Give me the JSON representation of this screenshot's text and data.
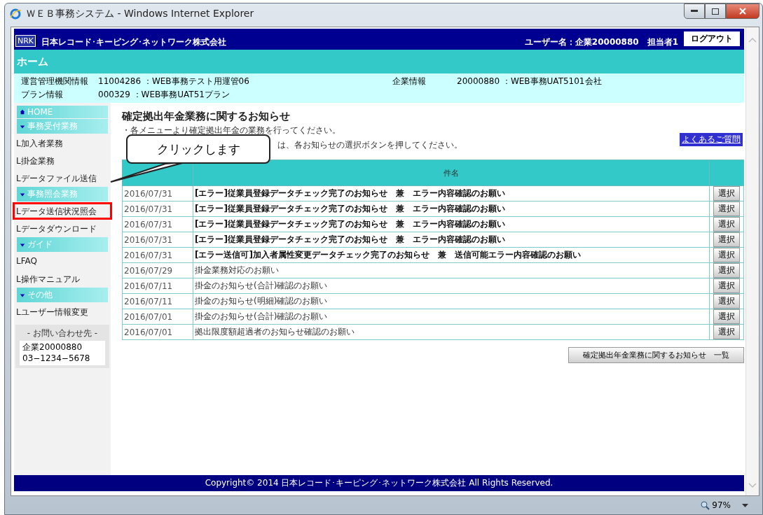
{
  "window": {
    "title": "ＷＥＢ事務システム - Windows Internet Explorer",
    "zoom": "97%"
  },
  "header": {
    "logo": "NRK",
    "company": "日本レコード･キーピング･ネットワーク株式会社",
    "user": "ユーザー名：企業20000880　担当者1",
    "logout": "ログアウト"
  },
  "page_title": "ホーム",
  "info": [
    {
      "label": "運営管理機関情報",
      "value": "11004286 ：WEB事務テスト用運管06"
    },
    {
      "label": "企業情報",
      "value": "20000880 ：WEB事務UAT5101会社"
    },
    {
      "label": "プラン情報",
      "value": "000329 ：WEB事務UAT51プラン"
    }
  ],
  "sidebar": {
    "items": [
      {
        "kind": "home",
        "label": "HOME"
      },
      {
        "kind": "section",
        "label": "事務受付業務"
      },
      {
        "kind": "link",
        "label": "L加入者業務",
        "highlighted": false
      },
      {
        "kind": "link",
        "label": "L掛金業務",
        "highlighted": false
      },
      {
        "kind": "link",
        "label": "Lデータファイル送信",
        "highlighted": false
      },
      {
        "kind": "section",
        "label": "事務照会業務"
      },
      {
        "kind": "link",
        "label": "Lデータ送信状況照会",
        "highlighted": true
      },
      {
        "kind": "link",
        "label": "Lデータダウンロード",
        "highlighted": false
      },
      {
        "kind": "section",
        "label": "ガイド"
      },
      {
        "kind": "link",
        "label": "LFAQ",
        "highlighted": false
      },
      {
        "kind": "link",
        "label": "L操作マニュアル",
        "highlighted": false
      },
      {
        "kind": "section",
        "label": "その他"
      },
      {
        "kind": "link",
        "label": "Lユーザー情報変更",
        "highlighted": false
      }
    ],
    "contact": {
      "title": "- お問い合わせ先 -",
      "lines": [
        "企業20000880",
        "03−1234−5678"
      ]
    }
  },
  "callout": "クリックします",
  "main": {
    "heading": "確定拠出年金業務に関するお知らせ",
    "notes": [
      "・各メニューより確定拠出年金の業務を行ってください。",
      "は、各お知らせの選択ボタンを押してください。"
    ],
    "faq_link": "よくあるご質問",
    "table": {
      "subject_header": "件名",
      "rows": [
        {
          "date": "2016/07/31",
          "subject": "[エラー]従業員登録データチェック完了のお知らせ　兼　エラー内容確認のお願い",
          "emphasis": true,
          "button": "選択"
        },
        {
          "date": "2016/07/31",
          "subject": "[エラー]従業員登録データチェック完了のお知らせ　兼　エラー内容確認のお願い",
          "emphasis": true,
          "button": "選択"
        },
        {
          "date": "2016/07/31",
          "subject": "[エラー]従業員登録データチェック完了のお知らせ　兼　エラー内容確認のお願い",
          "emphasis": true,
          "button": "選択"
        },
        {
          "date": "2016/07/31",
          "subject": "[エラー]従業員登録データチェック完了のお知らせ　兼　エラー内容確認のお願い",
          "emphasis": true,
          "button": "選択"
        },
        {
          "date": "2016/07/31",
          "subject": "[エラー送信可]加入者属性変更データチェック完了のお知らせ　兼　送信可能エラー内容確認のお願い",
          "emphasis": true,
          "button": "選択"
        },
        {
          "date": "2016/07/29",
          "subject": "掛金業務対応のお願い",
          "emphasis": false,
          "button": "選択"
        },
        {
          "date": "2016/07/11",
          "subject": "掛金のお知らせ(合計)確認のお願い",
          "emphasis": false,
          "button": "選択"
        },
        {
          "date": "2016/07/11",
          "subject": "掛金のお知らせ(明細)確認のお願い",
          "emphasis": false,
          "button": "選択"
        },
        {
          "date": "2016/07/01",
          "subject": "掛金のお知らせ(合計)確認のお願い",
          "emphasis": false,
          "button": "選択"
        },
        {
          "date": "2016/07/01",
          "subject": "拠出限度額超過者のお知らせ確認のお願い",
          "emphasis": false,
          "button": "選択"
        }
      ]
    },
    "list_button": "確定拠出年金業務に関するお知らせ　一覧"
  },
  "footer": "Copyright© 2014 日本レコード･キーピング･ネットワーク株式会社 All Rights Reserved."
}
